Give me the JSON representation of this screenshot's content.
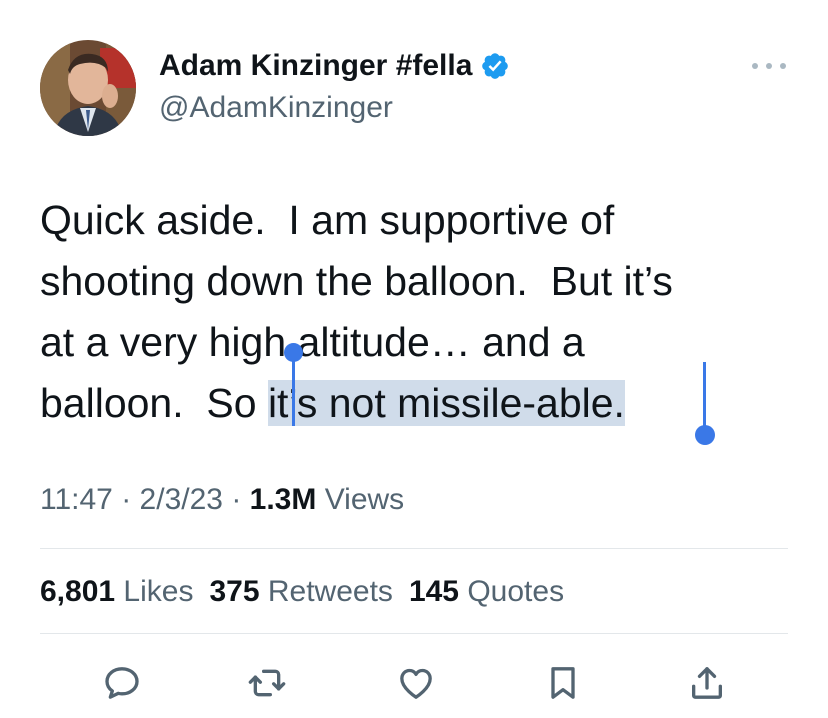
{
  "author": {
    "display_name": "Adam Kinzinger #fella",
    "handle": "@AdamKinzinger",
    "verified": true
  },
  "tweet": {
    "text_lines": [
      "Quick aside.  I am supportive of",
      "shooting down the balloon.  But it’s",
      "at a very high altitude… and a"
    ],
    "last_line_before_selection": "balloon.  So ",
    "selected_text": "it’s not missile-able."
  },
  "meta": {
    "time": "11:47",
    "separator": "·",
    "date": "2/3/23",
    "views_count": "1.3M",
    "views_label": "Views"
  },
  "stats": {
    "likes_count": "6,801",
    "likes_label": "Likes",
    "retweets_count": "375",
    "retweets_label": "Retweets",
    "quotes_count": "145",
    "quotes_label": "Quotes"
  },
  "colors": {
    "text": "#0f1419",
    "secondary": "#536471",
    "verified": "#1d9bf0",
    "selection": "#d0dcea",
    "selection_handle": "#3a78e7",
    "divider": "#e3e7ea"
  },
  "icons": {
    "reply": "reply-icon",
    "retweet": "retweet-icon",
    "like": "heart-icon",
    "bookmark": "bookmark-icon",
    "share": "share-icon",
    "more": "more-icon"
  }
}
